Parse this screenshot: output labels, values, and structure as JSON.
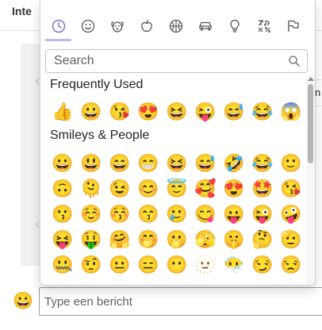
{
  "background": {
    "title": "Inte",
    "right_text": "n"
  },
  "picker": {
    "tabs": [
      {
        "icon": "clock-icon",
        "label": "Recent",
        "active": true
      },
      {
        "icon": "smiley-icon",
        "label": "Smileys & People",
        "active": false
      },
      {
        "icon": "dog-icon",
        "label": "Animals & Nature",
        "active": false
      },
      {
        "icon": "apple-icon",
        "label": "Food & Drink",
        "active": false
      },
      {
        "icon": "basketball-icon",
        "label": "Activity",
        "active": false
      },
      {
        "icon": "car-icon",
        "label": "Travel & Places",
        "active": false
      },
      {
        "icon": "lightbulb-icon",
        "label": "Objects",
        "active": false
      },
      {
        "icon": "symbols-icon",
        "label": "Symbols",
        "active": false
      },
      {
        "icon": "flags-icon",
        "label": "Flags",
        "active": false
      }
    ],
    "accent_color": "#c4b5e8",
    "search": {
      "placeholder": "Search",
      "value": ""
    },
    "frequent": {
      "title": "Frequently Used",
      "emojis": [
        "👍",
        "😀",
        "😘",
        "😍",
        "😆",
        "😜",
        "😅",
        "😂",
        "😱"
      ]
    },
    "smileys": {
      "title": "Smileys & People",
      "rows": [
        [
          "😀",
          "😃",
          "😄",
          "😁",
          "😆",
          "😅",
          "🤣",
          "😂",
          "🙂"
        ],
        [
          "🙃",
          "🫠",
          "😉",
          "😊",
          "😇",
          "🥰",
          "😍",
          "🤩",
          "😘"
        ],
        [
          "😗",
          "☺️",
          "😚",
          "😙",
          "🥲",
          "😋",
          "😛",
          "😜",
          "🤪"
        ],
        [
          "😝",
          "🤑",
          "🤗",
          "🤭",
          "🫢",
          "🫣",
          "🤫",
          "🤔",
          "🫡"
        ],
        [
          "🤐",
          "🤨",
          "😐",
          "😑",
          "😶",
          "🫥",
          "😶‍🌫️",
          "😏",
          "😒"
        ]
      ]
    }
  },
  "composer": {
    "emoji_button": "😀",
    "placeholder": "Type een bericht"
  }
}
